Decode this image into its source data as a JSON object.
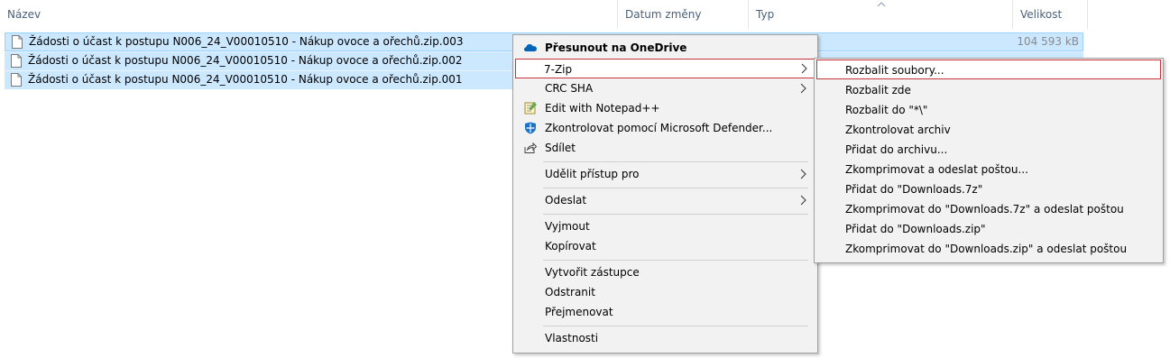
{
  "columns": {
    "name": "Název",
    "date": "Datum změny",
    "type": "Typ",
    "size": "Velikost"
  },
  "files": [
    {
      "name": "Žádosti o účast k postupu N006_24_V00010510 - Nákup ovoce a ořechů.zip.003",
      "size": "104 593 kB"
    },
    {
      "name": "Žádosti o účast k postupu N006_24_V00010510 - Nákup ovoce a ořechů.zip.002",
      "size": ""
    },
    {
      "name": "Žádosti o účast k postupu N006_24_V00010510 - Nákup ovoce a ořechů.zip.001",
      "size": ""
    }
  ],
  "context_menu": {
    "onedrive": "Přesunout na OneDrive",
    "sevenzip": "7-Zip",
    "crc_sha": "CRC SHA",
    "notepad": "Edit with Notepad++",
    "defender": "Zkontrolovat pomocí Microsoft Defender...",
    "share": "Sdílet",
    "grant_access": "Udělit přístup pro",
    "send_to": "Odeslat",
    "cut": "Vyjmout",
    "copy": "Kopírovat",
    "create_shortcut": "Vytvořit zástupce",
    "delete": "Odstranit",
    "rename": "Přejmenovat",
    "properties": "Vlastnosti"
  },
  "sevenzip_menu": {
    "extract_files": "Rozbalit soubory...",
    "extract_here": "Rozbalit zde",
    "extract_to": "Rozbalit do \"*\\\"",
    "test_archive": "Zkontrolovat archiv",
    "add_to_archive": "Přidat do archivu...",
    "compress_email": "Zkomprimovat a odeslat poštou...",
    "add_to_7z": "Přidat do \"Downloads.7z\"",
    "compress_7z_email": "Zkomprimovat do \"Downloads.7z\" a odeslat poštou",
    "add_to_zip": "Přidat do \"Downloads.zip\"",
    "compress_zip_email": "Zkomprimovat do \"Downloads.zip\" a odeslat poštou"
  },
  "icons": {
    "file": "file-icon",
    "onedrive": "onedrive-cloud-icon",
    "notepad": "notepad-plus-plus-icon",
    "defender": "defender-shield-icon",
    "share": "share-icon",
    "submenu": "chevron-right-icon",
    "sort": "sort-ascending-caret-icon"
  },
  "colors": {
    "selection": "#cce8ff",
    "selection_border": "#99d1ff",
    "menu_bg": "#f2f2f2",
    "highlight_border": "#c8323c",
    "onedrive_blue": "#0364b8",
    "header_text": "#4c607a"
  }
}
